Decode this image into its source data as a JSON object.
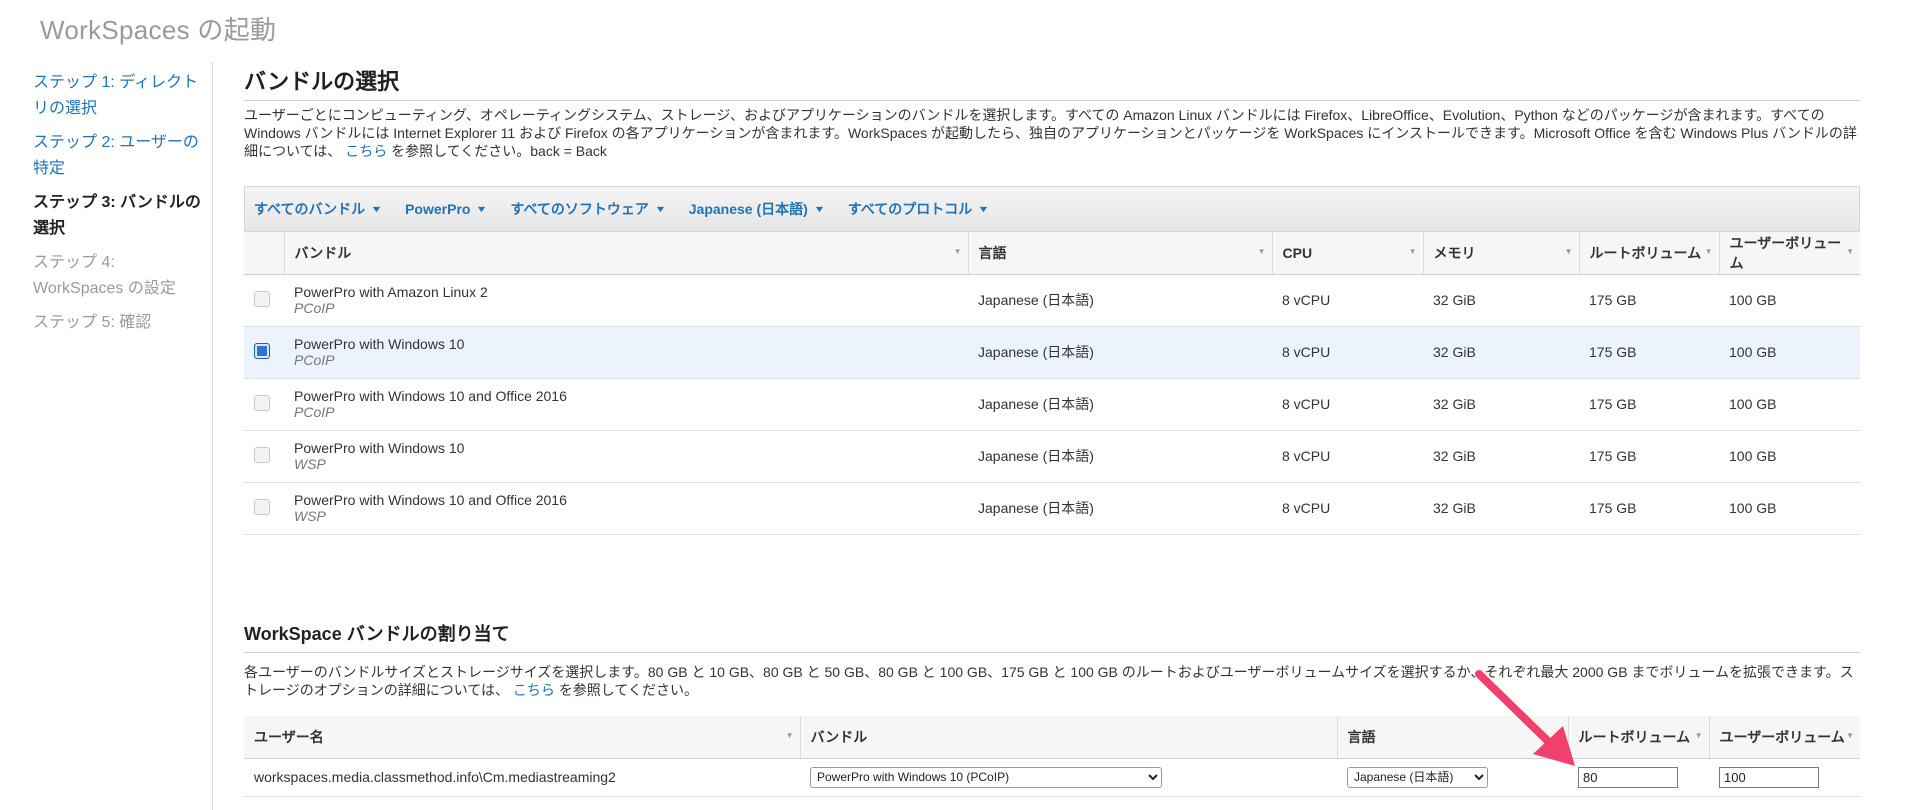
{
  "page": {
    "title": "WorkSpaces の起動"
  },
  "steps": [
    {
      "label": "ステップ 1: ディレクトリの選択",
      "state": "link"
    },
    {
      "label": "ステップ 2: ユーザーの特定",
      "state": "link"
    },
    {
      "label": "ステップ 3: バンドルの選択",
      "state": "current"
    },
    {
      "label": "ステップ 4: WorkSpaces の設定",
      "state": "disabled"
    },
    {
      "label": "ステップ 5: 確認",
      "state": "disabled"
    }
  ],
  "bundle_section": {
    "title": "バンドルの選択",
    "desc_before": "ユーザーごとにコンピューティング、オペレーティングシステム、ストレージ、およびアプリケーションのバンドルを選択します。すべての Amazon Linux バンドルには Firefox、LibreOffice、Evolution、Python などのパッケージが含まれます。すべての Windows バンドルには Internet Explorer 11 および Firefox の各アプリケーションが含まれます。WorkSpaces が起動したら、独自のアプリケーションとパッケージを WorkSpaces にインストールできます。Microsoft Office を含む Windows Plus バンドルの詳細については、",
    "desc_link": "こちら",
    "desc_after": "を参照してください。back = Back"
  },
  "filters": [
    {
      "label": "すべてのバンドル"
    },
    {
      "label": "PowerPro"
    },
    {
      "label": "すべてのソフトウェア"
    },
    {
      "label": "Japanese (日本語)"
    },
    {
      "label": "すべてのプロトコル"
    }
  ],
  "bundle_table": {
    "headers": {
      "bundle": "バンドル",
      "language": "言語",
      "cpu": "CPU",
      "memory": "メモリ",
      "root_volume": "ルートボリューム",
      "user_volume": "ユーザーボリューム"
    },
    "rows": [
      {
        "name": "PowerPro with Amazon Linux 2",
        "protocol": "PCoIP",
        "language": "Japanese (日本語)",
        "cpu": "8 vCPU",
        "memory": "32 GiB",
        "root": "175 GB",
        "user": "100 GB",
        "selected": false
      },
      {
        "name": "PowerPro with Windows 10",
        "protocol": "PCoIP",
        "language": "Japanese (日本語)",
        "cpu": "8 vCPU",
        "memory": "32 GiB",
        "root": "175 GB",
        "user": "100 GB",
        "selected": true
      },
      {
        "name": "PowerPro with Windows 10 and Office 2016",
        "protocol": "PCoIP",
        "language": "Japanese (日本語)",
        "cpu": "8 vCPU",
        "memory": "32 GiB",
        "root": "175 GB",
        "user": "100 GB",
        "selected": false
      },
      {
        "name": "PowerPro with Windows 10",
        "protocol": "WSP",
        "language": "Japanese (日本語)",
        "cpu": "8 vCPU",
        "memory": "32 GiB",
        "root": "175 GB",
        "user": "100 GB",
        "selected": false
      },
      {
        "name": "PowerPro with Windows 10 and Office 2016",
        "protocol": "WSP",
        "language": "Japanese (日本語)",
        "cpu": "8 vCPU",
        "memory": "32 GiB",
        "root": "175 GB",
        "user": "100 GB",
        "selected": false
      }
    ]
  },
  "assign_section": {
    "title": "WorkSpace バンドルの割り当て",
    "desc_before": "各ユーザーのバンドルサイズとストレージサイズを選択します。80 GB と 10 GB、80 GB と 50 GB、80 GB と 100 GB、175 GB と 100 GB のルートおよびユーザーボリュームサイズを選択するか、それぞれ最大 2000 GB までボリュームを拡張できます。ストレージのオプションの詳細については、",
    "desc_link": "こちら",
    "desc_after": "を参照してください。"
  },
  "assign_table": {
    "headers": {
      "username": "ユーザー名",
      "bundle": "バンドル",
      "language": "言語",
      "root_volume": "ルートボリューム",
      "user_volume": "ユーザーボリューム"
    },
    "row": {
      "username": "workspaces.media.classmethod.info\\Cm.mediastreaming2",
      "bundle_value": "PowerPro with Windows 10 (PCoIP)",
      "language_value": "Japanese (日本語)",
      "root_value": "80",
      "user_value": "100"
    }
  },
  "colors": {
    "link": "#1f73b7",
    "selected_row": "#ecf3fc",
    "arrow": "#f0406e"
  },
  "icons": {
    "dropdown": "caret-down-icon",
    "sort": "sort-icon",
    "annotation": "pink-arrow-icon"
  }
}
